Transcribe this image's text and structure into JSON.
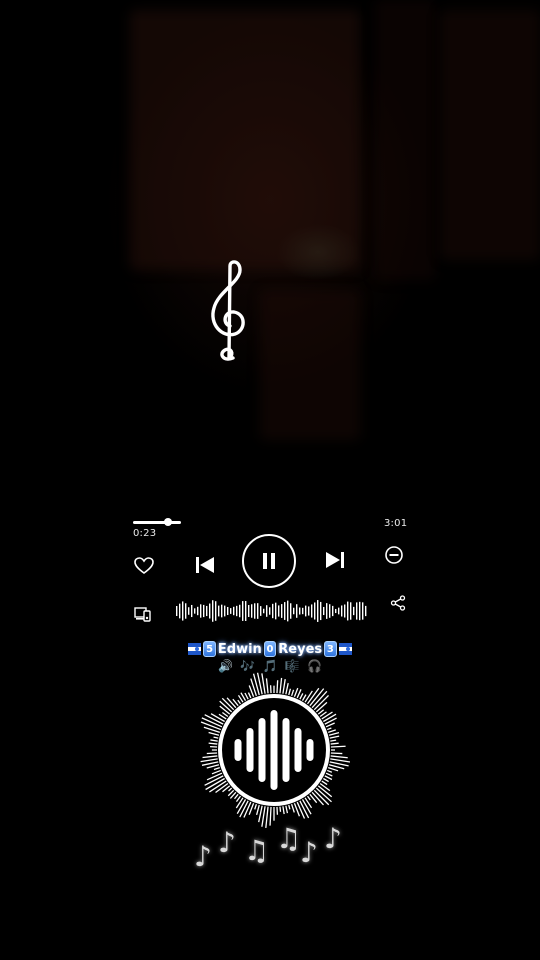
{
  "player": {
    "elapsed": "0:23",
    "total": "3:01",
    "progress_fraction": 0.13
  },
  "artist_line": {
    "digit_1": "5",
    "name_1": "Edwin",
    "digit_2": "0",
    "name_2": "Reyes",
    "digit_3": "3"
  },
  "icons": {
    "clef": "treble-clef-icon",
    "heart": "heart-icon",
    "prev": "skip-previous-icon",
    "pause": "pause-icon",
    "next": "skip-next-icon",
    "minus": "minus-circle-icon",
    "device": "device-icon",
    "share": "share-icon",
    "flag": "honduras-flag-icon",
    "emojis": [
      "speaker-icon",
      "notes-icon",
      "note-icon",
      "sheet-music-icon",
      "headphones-icon"
    ],
    "visualizer": "audio-visualizer-icon"
  },
  "emoji_row": [
    "🔊",
    "🎶",
    "🎵",
    "🎼",
    "🎧"
  ],
  "notes": [
    "♪",
    "♪",
    "♫",
    "♫",
    "♪",
    "♪"
  ],
  "colors": {
    "background": "#000000",
    "foreground": "#ffffff",
    "keycap": "#2f74de"
  }
}
